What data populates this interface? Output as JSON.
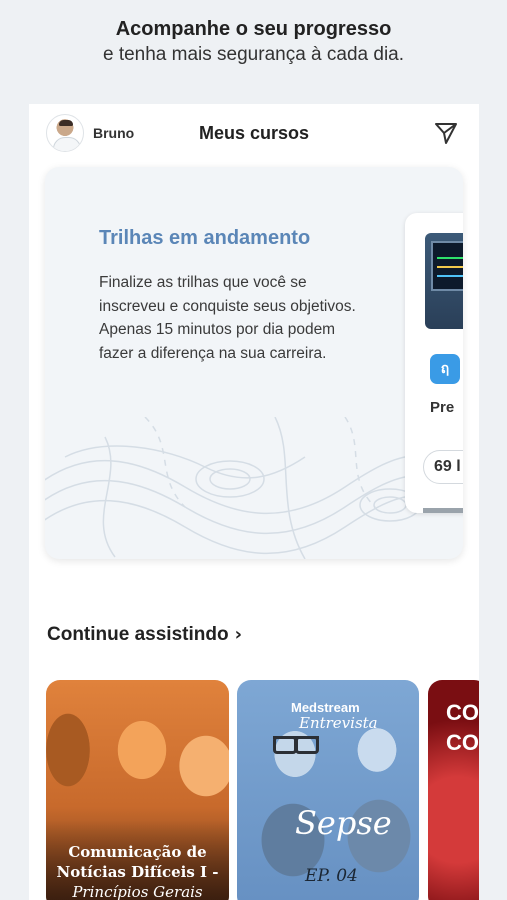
{
  "promo": {
    "headline": "Acompanhe o seu progresso",
    "subline": "e tenha mais segurança à cada dia."
  },
  "header": {
    "user_name": "Bruno",
    "title": "Meus cursos"
  },
  "trails": {
    "title": "Trilhas em andamento",
    "description": "Finalize as trilhas que você se inscreveu e conquiste seus objetivos. Apenas 15 minutos por dia podem fazer a diferença na sua carreira.",
    "card": {
      "icon_letter": "ฤ",
      "label": "Pre",
      "pill": "69 l"
    }
  },
  "continue": {
    "title": "Continue assistindo",
    "items": [
      {
        "line1": "Comunicação de",
        "line2": "Notícias Difíceis I -",
        "line3": "Princípios Gerais"
      },
      {
        "brand": "Medstream",
        "brand_script": "Entrevista",
        "topic": "Sepse",
        "episode": "EP. 04"
      },
      {
        "partial": "CO\nCO"
      }
    ]
  },
  "colors": {
    "accent_blue": "#5b86b7",
    "icon_blue": "#3a9be6",
    "background": "#eef1f4"
  },
  "icons": [
    "avatar",
    "send-icon",
    "chevron-right-icon",
    "app-icon"
  ]
}
